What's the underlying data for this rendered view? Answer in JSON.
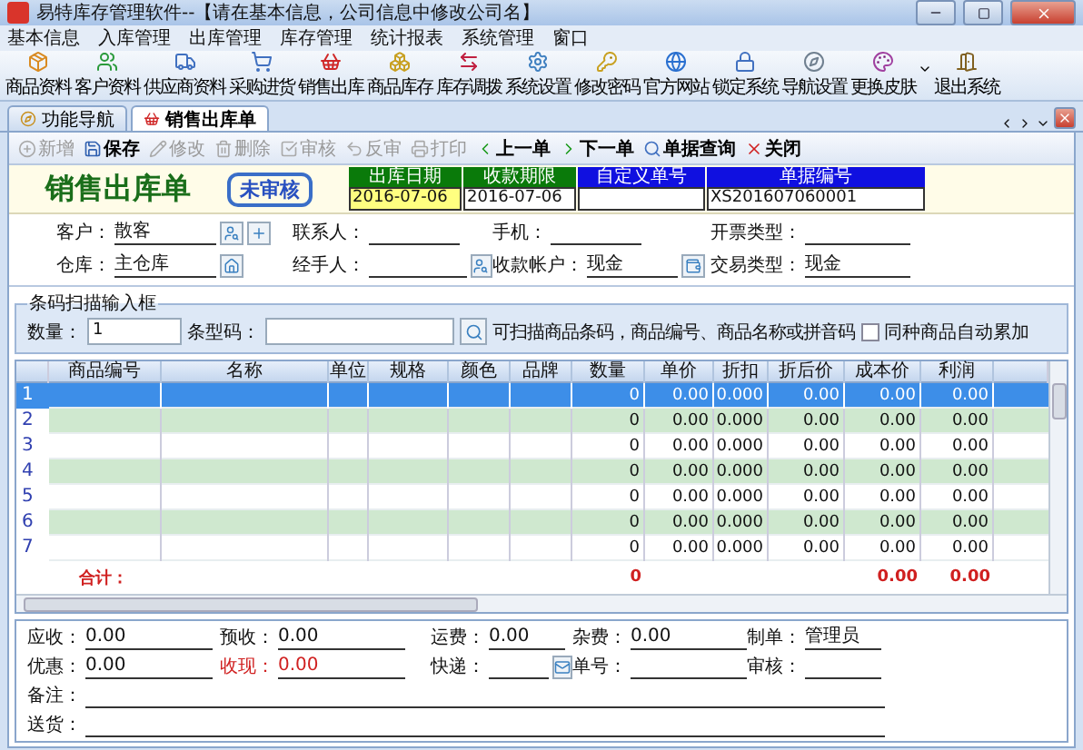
{
  "window": {
    "title": "易特库存管理软件--【请在基本信息，公司信息中修改公司名】"
  },
  "menu": [
    "基本信息",
    "入库管理",
    "出库管理",
    "库存管理",
    "统计报表",
    "系统管理",
    "窗口"
  ],
  "toolbar": [
    {
      "label": "商品资料",
      "dropdown": false
    },
    {
      "label": "客户资料",
      "dropdown": false
    },
    {
      "label": "供应商资料",
      "dropdown": false
    },
    {
      "label": "采购进货",
      "dropdown": false
    },
    {
      "label": "销售出库",
      "dropdown": false
    },
    {
      "label": "商品库存",
      "dropdown": false
    },
    {
      "label": "库存调拨",
      "dropdown": false
    },
    {
      "label": "系统设置",
      "dropdown": false
    },
    {
      "label": "修改密码",
      "dropdown": false
    },
    {
      "label": "官方网站",
      "dropdown": false
    },
    {
      "label": "锁定系统",
      "dropdown": false
    },
    {
      "label": "导航设置",
      "dropdown": false
    },
    {
      "label": "更换皮肤",
      "dropdown": true
    },
    {
      "label": "退出系统",
      "dropdown": false
    }
  ],
  "tabs": [
    {
      "label": "功能导航",
      "selected": false
    },
    {
      "label": "销售出库单",
      "selected": true
    }
  ],
  "actions": [
    {
      "label": "新增",
      "disabled": true
    },
    {
      "label": "保存",
      "disabled": false
    },
    {
      "label": "修改",
      "disabled": true
    },
    {
      "label": "删除",
      "disabled": true
    },
    {
      "label": "审核",
      "disabled": true
    },
    {
      "label": "反审",
      "disabled": true
    },
    {
      "label": "打印",
      "disabled": true
    },
    {
      "label": "上一单",
      "disabled": false
    },
    {
      "label": "下一单",
      "disabled": false
    },
    {
      "label": "单据查询",
      "disabled": false
    },
    {
      "label": "关闭",
      "disabled": false
    }
  ],
  "form": {
    "title": "销售出库单",
    "status": "未审核",
    "header_fields": [
      {
        "label": "出库日期",
        "value": "2016-07-06",
        "color": "#0a7a0a",
        "highlighted": true
      },
      {
        "label": "收款期限",
        "value": "2016-07-06",
        "color": "#0a7a0a",
        "highlighted": false
      },
      {
        "label": "自定义单号",
        "color": "#1010e0",
        "highlighted": false
      },
      {
        "label": "单据编号",
        "value": "XS201607060001",
        "color": "#1010e0",
        "highlighted": false
      }
    ],
    "fields": [
      [
        {
          "label": "客户：",
          "value": "散客",
          "kind": "lookup_add"
        },
        {
          "label": "联系人：",
          "kind": "text"
        },
        {
          "label": "手机：",
          "kind": "text"
        },
        {
          "label": "开票类型：",
          "kind": "text"
        }
      ],
      [
        {
          "label": "仓库：",
          "value": "主仓库",
          "kind": "store"
        },
        {
          "label": "经手人：",
          "kind": "lookup"
        },
        {
          "label": "收款帐户：",
          "value": "现金",
          "kind": "account"
        },
        {
          "label": "交易类型：",
          "value": "现金",
          "kind": "text"
        }
      ]
    ]
  },
  "barcode": {
    "title": "条码扫描输入框",
    "quantity_label": "数量：",
    "quantity": "1",
    "barcode_label": "条型码：",
    "hint": "可扫描商品条码，商品编号、商品名称或拼音码",
    "auto_merge": {
      "label": "同种商品自动累加",
      "checked": false
    }
  },
  "grid": {
    "columns": [
      "商品编号",
      "名称",
      "单位",
      "规格",
      "颜色",
      "品牌",
      "数量",
      "单价",
      "折扣",
      "折后价",
      "成本价",
      "利润"
    ],
    "rows": [
      {
        "no": "1",
        "selected": true,
        "qty": "0",
        "price": "0.00",
        "discount": "0.000",
        "net_price": "0.00",
        "cost": "0.00",
        "profit": "0.00"
      },
      {
        "no": "2",
        "selected": false,
        "qty": "0",
        "price": "0.00",
        "discount": "0.000",
        "net_price": "0.00",
        "cost": "0.00",
        "profit": "0.00"
      },
      {
        "no": "3",
        "selected": false,
        "qty": "0",
        "price": "0.00",
        "discount": "0.000",
        "net_price": "0.00",
        "cost": "0.00",
        "profit": "0.00"
      },
      {
        "no": "4",
        "selected": false,
        "qty": "0",
        "price": "0.00",
        "discount": "0.000",
        "net_price": "0.00",
        "cost": "0.00",
        "profit": "0.00"
      },
      {
        "no": "5",
        "selected": false,
        "qty": "0",
        "price": "0.00",
        "discount": "0.000",
        "net_price": "0.00",
        "cost": "0.00",
        "profit": "0.00"
      },
      {
        "no": "6",
        "selected": false,
        "qty": "0",
        "price": "0.00",
        "discount": "0.000",
        "net_price": "0.00",
        "cost": "0.00",
        "profit": "0.00"
      },
      {
        "no": "7",
        "selected": false,
        "qty": "0",
        "price": "0.00",
        "discount": "0.000",
        "net_price": "0.00",
        "cost": "0.00",
        "profit": "0.00"
      }
    ],
    "total": {
      "label": "合计：",
      "qty": "0",
      "cost": "0.00",
      "profit": "0.00"
    }
  },
  "footer": {
    "rows": [
      [
        {
          "label": "应收：",
          "value": "0.00",
          "kind": "text",
          "alert": false
        },
        {
          "label": "预收：",
          "value": "0.00",
          "kind": "text",
          "alert": false
        },
        {
          "label": "运费：",
          "value": "0.00",
          "kind": "text",
          "alert": false
        },
        {
          "label": "杂费：",
          "value": "0.00",
          "kind": "text",
          "alert": false
        },
        {
          "label": "制单：",
          "value": "管理员",
          "kind": "text",
          "alert": false
        }
      ],
      [
        {
          "label": "优惠：",
          "value": "0.00",
          "kind": "text",
          "alert": false
        },
        {
          "label": "收现：",
          "value": "0.00",
          "kind": "text",
          "alert": true
        },
        {
          "label": "快递：",
          "kind": "lookup",
          "alert": false
        },
        {
          "label": "单号：",
          "kind": "text",
          "alert": false
        },
        {
          "label": "审核：",
          "kind": "text",
          "alert": false
        }
      ]
    ],
    "notes": [
      {
        "label": "备注："
      },
      {
        "label": "送货："
      }
    ]
  }
}
